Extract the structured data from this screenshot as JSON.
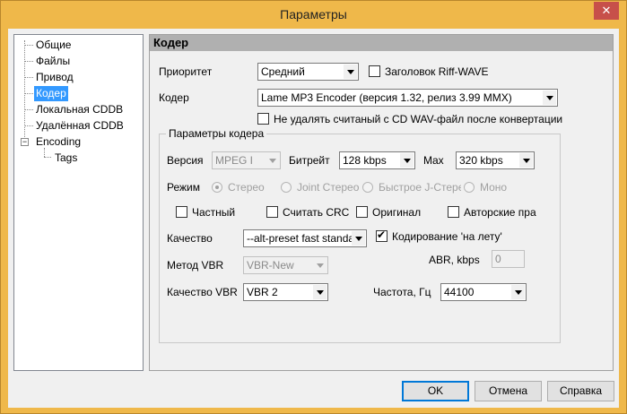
{
  "window": {
    "title": "Параметры"
  },
  "tree": {
    "items": [
      {
        "label": "Общие"
      },
      {
        "label": "Файлы"
      },
      {
        "label": "Привод"
      },
      {
        "label": "Кодер"
      },
      {
        "label": "Локальная CDDB"
      },
      {
        "label": "Удалённая CDDB"
      },
      {
        "label": "Encoding"
      },
      {
        "label": "Tags"
      }
    ],
    "selected": "Кодер"
  },
  "panel": {
    "header": "Кодер",
    "priority_label": "Приоритет",
    "priority_value": "Средний",
    "riff_wave_label": "Заголовок Riff-WAVE",
    "encoder_label": "Кодер",
    "encoder_value": "Lame MP3 Encoder (версия 1.32, релиз 3.99 MMX)",
    "keep_wav_label": "Не удалять считаный с CD WAV-файл после конвертации",
    "group": {
      "title": "Параметры кодера",
      "version_label": "Версия",
      "version_value": "MPEG I",
      "bitrate_label": "Битрейт",
      "bitrate_value": "128 kbps",
      "max_label": "Max",
      "max_value": "320 kbps",
      "mode_label": "Режим",
      "modes": [
        "Стерео",
        "Joint Стерео",
        "Быстрое J-Стерео",
        "Моно"
      ],
      "private_label": "Частный",
      "crc_label": "Считать CRC",
      "original_label": "Оригинал",
      "copyright_label": "Авторские пра",
      "quality_label": "Качество",
      "quality_value": "--alt-preset fast standard",
      "onthefly_label": "Кодирование 'на лету'",
      "vbr_method_label": "Метод VBR",
      "vbr_method_value": "VBR-New",
      "abr_label": "ABR, kbps",
      "abr_value": "0",
      "vbr_quality_label": "Качество VBR",
      "vbr_quality_value": "VBR 2",
      "freq_label": "Частота, Гц",
      "freq_value": "44100"
    }
  },
  "buttons": {
    "ok": "OK",
    "cancel": "Отмена",
    "help": "Справка"
  }
}
